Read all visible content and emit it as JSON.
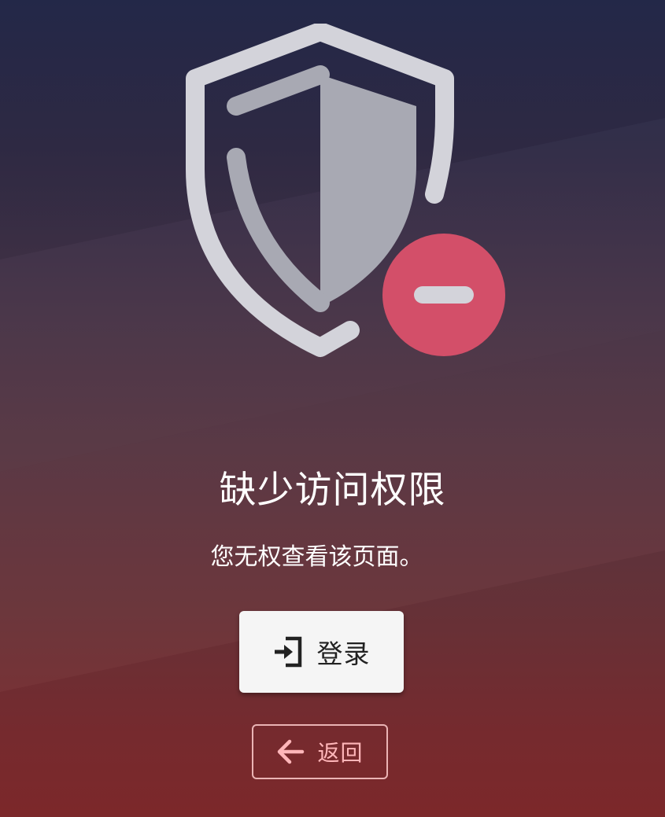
{
  "page": {
    "title": "缺少访问权限",
    "message": "您无权查看该页面。"
  },
  "actions": {
    "login_label": "登录",
    "back_label": "返回"
  },
  "icons": {
    "illustration": "shield-with-minus-icon",
    "login": "login-enter-icon",
    "back": "arrow-left-icon"
  },
  "colors": {
    "background_top": "#24294a",
    "background_bottom": "#802a2c",
    "shield": "#d2d2d8",
    "badge": "#d34f69",
    "back_accent": "#ffb6b9",
    "login_bg": "#f5f5f5"
  }
}
